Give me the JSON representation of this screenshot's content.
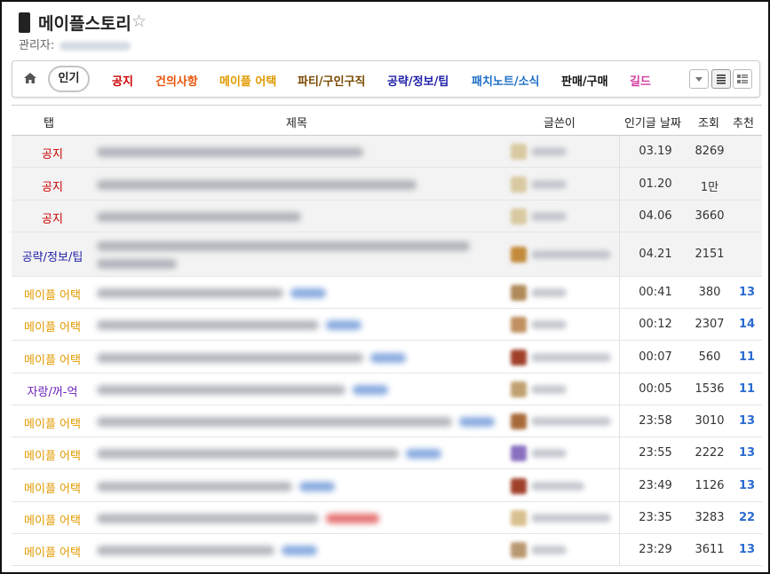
{
  "header": {
    "title": "메이플스토리",
    "star_glyph": "☆",
    "manager_label": "관리자:"
  },
  "tabbar": {
    "popular_label": "인기",
    "tabs": [
      {
        "label": "공지",
        "color": "#cc0000"
      },
      {
        "label": "건의사항",
        "color": "#e8550a"
      },
      {
        "label": "메이플 어택",
        "color": "#e19a00"
      },
      {
        "label": "파티/구인구직",
        "color": "#7a4a00"
      },
      {
        "label": "공략/정보/팁",
        "color": "#1f1fa8"
      },
      {
        "label": "패치노트/소식",
        "color": "#1e6fc7"
      },
      {
        "label": "판매/구매",
        "color": "#111111"
      },
      {
        "label": "길드",
        "color": "#d23aa0"
      }
    ]
  },
  "table": {
    "headers": {
      "tab": "탭",
      "title": "제목",
      "author": "글쓴이",
      "date": "인기글 날짜",
      "views": "조회",
      "recommend": "추천"
    },
    "rows": [
      {
        "tab": "공지",
        "tab_color": "#cc0000",
        "date": "03.19",
        "views": "8269",
        "recommend": "",
        "notice": true
      },
      {
        "tab": "공지",
        "tab_color": "#cc0000",
        "date": "01.20",
        "views": "1만",
        "recommend": "",
        "notice": true
      },
      {
        "tab": "공지",
        "tab_color": "#cc0000",
        "date": "04.06",
        "views": "3660",
        "recommend": "",
        "notice": true
      },
      {
        "tab": "공략/정보/팁",
        "tab_color": "#1f1fa8",
        "date": "04.21",
        "views": "2151",
        "recommend": "",
        "notice": true
      },
      {
        "tab": "메이플 어택",
        "tab_color": "#e19a00",
        "date": "00:41",
        "views": "380",
        "recommend": "13",
        "notice": false
      },
      {
        "tab": "메이플 어택",
        "tab_color": "#e19a00",
        "date": "00:12",
        "views": "2307",
        "recommend": "14",
        "notice": false
      },
      {
        "tab": "메이플 어택",
        "tab_color": "#e19a00",
        "date": "00:07",
        "views": "560",
        "recommend": "11",
        "notice": false
      },
      {
        "tab": "자랑/꺼-억",
        "tab_color": "#6a1fb8",
        "date": "00:05",
        "views": "1536",
        "recommend": "11",
        "notice": false
      },
      {
        "tab": "메이플 어택",
        "tab_color": "#e19a00",
        "date": "23:58",
        "views": "3010",
        "recommend": "13",
        "notice": false
      },
      {
        "tab": "메이플 어택",
        "tab_color": "#e19a00",
        "date": "23:55",
        "views": "2222",
        "recommend": "13",
        "notice": false
      },
      {
        "tab": "메이플 어택",
        "tab_color": "#e19a00",
        "date": "23:49",
        "views": "1126",
        "recommend": "13",
        "notice": false
      },
      {
        "tab": "메이플 어택",
        "tab_color": "#e19a00",
        "date": "23:35",
        "views": "3283",
        "recommend": "22",
        "notice": false
      },
      {
        "tab": "메이플 어택",
        "tab_color": "#e19a00",
        "date": "23:29",
        "views": "3611",
        "recommend": "13",
        "notice": false
      }
    ]
  }
}
